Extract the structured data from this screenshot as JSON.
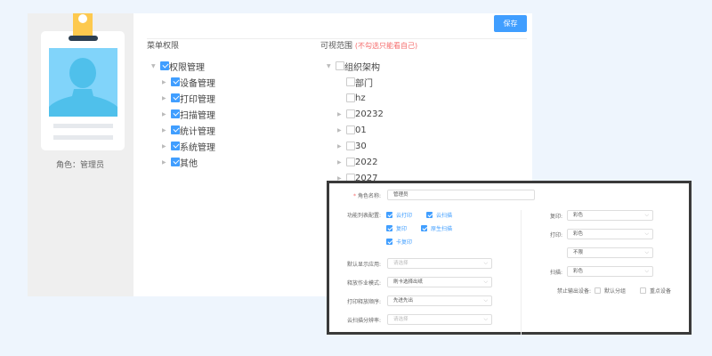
{
  "role_card": {
    "role_label": "角色：管理员"
  },
  "toolbar": {
    "save_label": "保存"
  },
  "menu_perms": {
    "title": "菜单权限",
    "root": {
      "label": "权限管理",
      "checked": true
    },
    "children": [
      {
        "label": "设备管理",
        "checked": true
      },
      {
        "label": "打印管理",
        "checked": true
      },
      {
        "label": "扫描管理",
        "checked": true
      },
      {
        "label": "统计管理",
        "checked": true
      },
      {
        "label": "系统管理",
        "checked": true
      },
      {
        "label": "其他",
        "checked": true
      }
    ]
  },
  "visible_scope": {
    "title": "可视范围",
    "hint": "(不勾选只能看自己)",
    "root": {
      "label": "组织架构",
      "checked": false
    },
    "children": [
      {
        "label": "部门",
        "expandable": false
      },
      {
        "label": "hz",
        "expandable": false
      },
      {
        "label": "20232",
        "expandable": true
      },
      {
        "label": "01",
        "expandable": true
      },
      {
        "label": "30",
        "expandable": true
      },
      {
        "label": "2022",
        "expandable": true
      },
      {
        "label": "2027",
        "expandable": true
      }
    ]
  },
  "role_form": {
    "role_name": {
      "label": "角色名称:",
      "value": "管理员",
      "required_mark": "*"
    },
    "features": {
      "label": "功能列表配置:",
      "options": [
        {
          "label": "云打印",
          "checked": true
        },
        {
          "label": "云扫描",
          "checked": true
        },
        {
          "label": "复印",
          "checked": true
        },
        {
          "label": "原生扫描",
          "checked": true
        },
        {
          "label": "卡复印",
          "checked": true
        }
      ]
    },
    "default_app": {
      "label": "默认显示应用:",
      "placeholder": "请选择"
    },
    "release_mode": {
      "label": "释放作业模式:",
      "value": "刷卡选择出纸"
    },
    "release_order": {
      "label": "打印释放顺序:",
      "value": "先进先出"
    },
    "scan_resolution": {
      "label": "云扫描分辨率:",
      "placeholder": "请选择"
    },
    "copy": {
      "label": "复印:",
      "value": "彩色"
    },
    "print": {
      "label": "打印:",
      "value": "彩色",
      "value2": "不限"
    },
    "scan": {
      "label": "扫描:",
      "value": "彩色"
    },
    "forbid_output": {
      "label": "禁止输出设备:",
      "options": [
        {
          "label": "默认分组",
          "checked": false
        },
        {
          "label": "重点设备",
          "checked": false
        }
      ]
    }
  },
  "colors": {
    "accent": "#409eff",
    "background": "#eef5fd",
    "hint": "#f56c6c"
  }
}
